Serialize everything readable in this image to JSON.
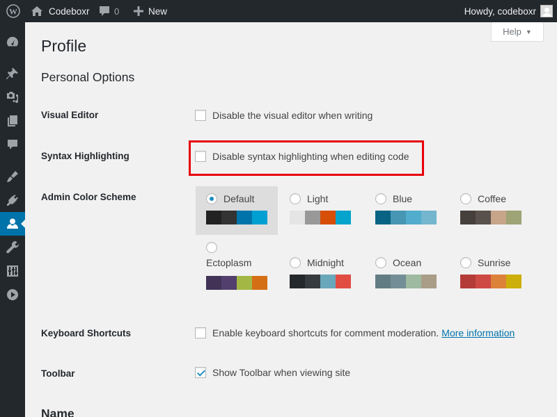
{
  "adminbar": {
    "site_name": "Codeboxr",
    "comments_count": "0",
    "new_label": "New",
    "howdy": "Howdy, codeboxr"
  },
  "sidebar": {
    "items": [
      {
        "icon": "dashboard-icon"
      },
      {
        "icon": "pin-icon"
      },
      {
        "icon": "media-icon"
      },
      {
        "icon": "pages-icon"
      },
      {
        "icon": "comments-icon"
      },
      {
        "icon": "appearance-icon"
      },
      {
        "icon": "plugins-icon"
      },
      {
        "icon": "users-icon",
        "current": true
      },
      {
        "icon": "tools-icon"
      },
      {
        "icon": "settings-icon"
      },
      {
        "icon": "collapse-icon"
      }
    ]
  },
  "help": {
    "label": "Help",
    "caret": "▼"
  },
  "page": {
    "title": "Profile",
    "section_personal": "Personal Options",
    "section_name": "Name"
  },
  "rows": {
    "visual_editor": {
      "label": "Visual Editor",
      "option": "Disable the visual editor when writing",
      "checked": false
    },
    "syntax": {
      "label": "Syntax Highlighting",
      "option": "Disable syntax highlighting when editing code",
      "checked": false
    },
    "color_scheme": {
      "label": "Admin Color Scheme"
    },
    "keyboard": {
      "label": "Keyboard Shortcuts",
      "option": "Enable keyboard shortcuts for comment moderation.",
      "link": "More information",
      "checked": false
    },
    "toolbar": {
      "label": "Toolbar",
      "option": "Show Toolbar when viewing site",
      "checked": true
    }
  },
  "schemes": [
    {
      "name": "Default",
      "selected": true,
      "colors": [
        "#222222",
        "#333333",
        "#0073aa",
        "#00a0d2"
      ]
    },
    {
      "name": "Light",
      "selected": false,
      "colors": [
        "#e5e5e5",
        "#999999",
        "#d64e07",
        "#04a4cc"
      ]
    },
    {
      "name": "Blue",
      "selected": false,
      "colors": [
        "#096484",
        "#4796b3",
        "#52accc",
        "#74b6ce"
      ]
    },
    {
      "name": "Coffee",
      "selected": false,
      "colors": [
        "#46403c",
        "#59524c",
        "#c7a589",
        "#9ea476"
      ]
    },
    {
      "name": "Ectoplasm",
      "selected": false,
      "colors": [
        "#413256",
        "#523f6d",
        "#a3b745",
        "#d46f15"
      ]
    },
    {
      "name": "Midnight",
      "selected": false,
      "colors": [
        "#25282b",
        "#363b3f",
        "#69a8bb",
        "#e14d43"
      ]
    },
    {
      "name": "Ocean",
      "selected": false,
      "colors": [
        "#627c83",
        "#738e96",
        "#9ebaa0",
        "#aa9d88"
      ]
    },
    {
      "name": "Sunrise",
      "selected": false,
      "colors": [
        "#b43c38",
        "#cf4944",
        "#dd823b",
        "#ccaf0b"
      ]
    }
  ],
  "colors": {
    "adminbar_bg": "#23282d",
    "accent": "#0073aa",
    "highlight_border": "#e8000b"
  }
}
